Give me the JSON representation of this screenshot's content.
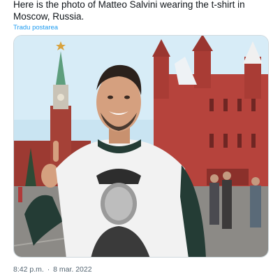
{
  "tweet": {
    "text": "Here is the photo of Matteo Salvini wearing the t-shirt in Moscow, Russia.",
    "translate_label": "Tradu postarea",
    "time": "8:42 p.m.",
    "separator": "·",
    "date": "8 mar. 2022"
  },
  "media": {
    "description_icon": "photo",
    "colors": {
      "sky": "#c9e4f2",
      "museum": "#b6433c",
      "tower": "#8a3a32",
      "spire": "#5d9e7d",
      "ground": "#8c8a86",
      "shirt": "#f2f2f2",
      "sleeve": "#243c35",
      "skin": "#d5a07f",
      "hair": "#2b211c"
    }
  }
}
